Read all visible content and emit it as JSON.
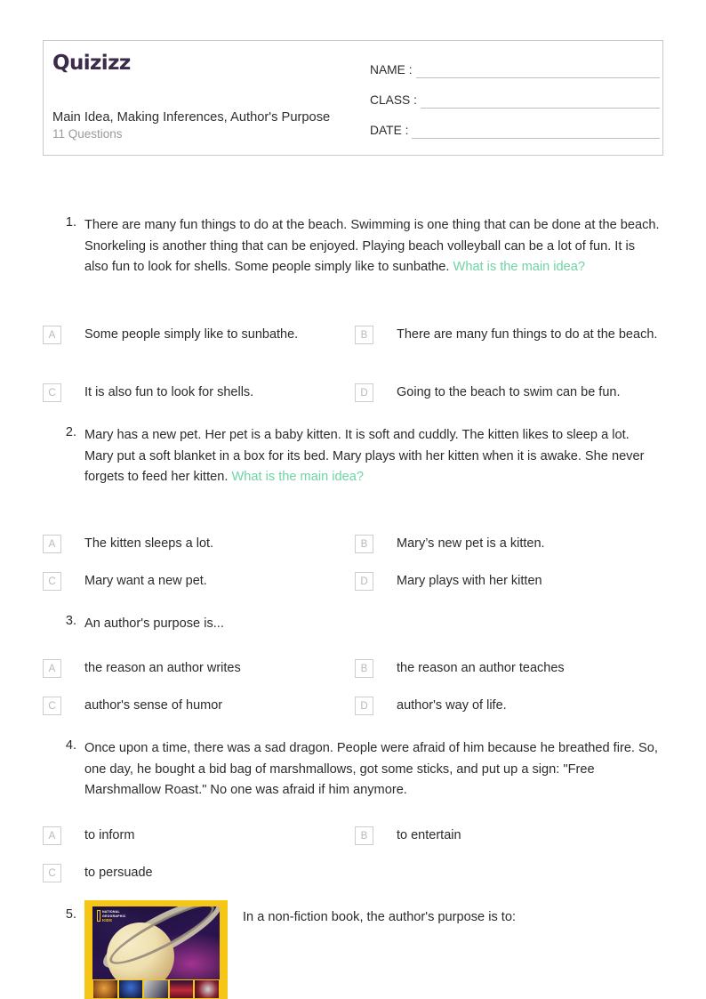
{
  "header": {
    "logo_text": "Quizizz",
    "quiz_title": "Main Idea, Making Inferences, Author's Purpose",
    "quiz_subtitle": "11 Questions",
    "fields": [
      {
        "label": "NAME :"
      },
      {
        "label": "CLASS :"
      },
      {
        "label": "DATE  :"
      }
    ]
  },
  "questions": [
    {
      "number": "1.",
      "text": "There are many fun things to do at the beach.  Swimming is one thing that can be done at the beach.  Snorkeling is another thing that can be enjoyed.  Playing beach volleyball can be a lot of fun.  It is also fun to look for shells.  Some people simply like to sunbathe.",
      "accent_text": "What is the main idea?",
      "options": [
        {
          "letter": "A",
          "text": "Some people simply like to sunbathe."
        },
        {
          "letter": "B",
          "text": "There are many fun things to do at the beach."
        },
        {
          "letter": "C",
          "text": "It is also fun to look for shells."
        },
        {
          "letter": "D",
          "text": "Going to the beach to swim can be fun."
        }
      ]
    },
    {
      "number": "2.",
      "text": "Mary has a new pet.  Her pet is a baby kitten.  It is soft and cuddly.  The kitten likes to sleep a lot.  Mary put a soft blanket in a box for its bed.  Mary plays with her kitten when it is awake.  She never forgets to feed her kitten.",
      "accent_text": "What is the main idea?",
      "options": [
        {
          "letter": "A",
          "text": "The kitten sleeps a lot."
        },
        {
          "letter": "B",
          "text": "Mary’s new pet is a kitten."
        },
        {
          "letter": "C",
          "text": "Mary want a new pet."
        },
        {
          "letter": "D",
          "text": "Mary plays with her kitten"
        }
      ]
    },
    {
      "number": "3.",
      "text": "An author's purpose is...",
      "accent_text": "",
      "options": [
        {
          "letter": "A",
          "text": "the reason an author writes"
        },
        {
          "letter": "B",
          "text": "the reason an author teaches"
        },
        {
          "letter": "C",
          "text": "author's sense of humor"
        },
        {
          "letter": "D",
          "text": "author's way of life."
        }
      ]
    },
    {
      "number": "4.",
      "text": "Once upon a time, there was a sad dragon. People were afraid of him because he breathed fire. So, one day, he bought a bid bag of marshmallows, got some sticks, and put up a sign: \"Free Marshmallow Roast.\" No one was afraid if him anymore.",
      "accent_text": "",
      "options": [
        {
          "letter": "A",
          "text": "to inform"
        },
        {
          "letter": "B",
          "text": "to entertain"
        },
        {
          "letter": "C",
          "text": "to persuade"
        }
      ]
    },
    {
      "number": "5.",
      "text_parts": {
        "before": "In a ",
        "highlight": "non-fiction book",
        "after": ", the author's purpose is to:"
      },
      "image": {
        "alt": "National Geographic Kids book cover with Saturn",
        "brand_line1": "NATIONAL",
        "brand_line2": "GEOGRAPHIC",
        "brand_line3": "KIDS"
      },
      "options": []
    }
  ],
  "colors": {
    "accent_green": "#6fd4a4",
    "highlight_red": "#ea5f7e",
    "logo_purple": "#3b2a4a",
    "border_gray": "#c9c9c9",
    "cover_yellow": "#f5c615"
  }
}
